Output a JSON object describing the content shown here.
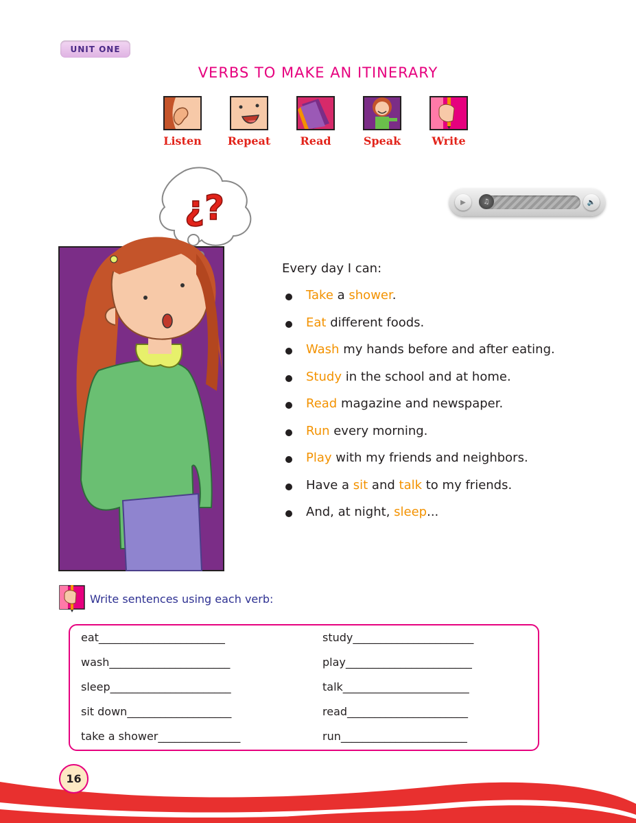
{
  "header": {
    "unit_label": "UNIT ONE",
    "title": "VERBS TO MAKE AN ITINERARY"
  },
  "skills": [
    {
      "label": "Listen",
      "icon": "ear-icon"
    },
    {
      "label": "Repeat",
      "icon": "talking-face-icon"
    },
    {
      "label": "Read",
      "icon": "book-icon"
    },
    {
      "label": "Speak",
      "icon": "speaking-girl-icon"
    },
    {
      "label": "Write",
      "icon": "pencil-hand-icon"
    }
  ],
  "illustration": {
    "thought_symbol": "¿?"
  },
  "content": {
    "intro": "Every day I can:",
    "items": [
      {
        "parts": [
          {
            "t": "Take",
            "hl": true
          },
          {
            "t": " a ",
            "hl": false
          },
          {
            "t": "shower",
            "hl": true
          },
          {
            "t": ".",
            "hl": false
          }
        ]
      },
      {
        "parts": [
          {
            "t": "Eat",
            "hl": true
          },
          {
            "t": " different foods.",
            "hl": false
          }
        ]
      },
      {
        "parts": [
          {
            "t": "Wash",
            "hl": true
          },
          {
            "t": " my hands before and after eating.",
            "hl": false
          }
        ]
      },
      {
        "parts": [
          {
            "t": "Study",
            "hl": true
          },
          {
            "t": " in the school and at home.",
            "hl": false
          }
        ]
      },
      {
        "parts": [
          {
            "t": "Read",
            "hl": true
          },
          {
            "t": " magazine and newspaper.",
            "hl": false
          }
        ]
      },
      {
        "parts": [
          {
            "t": "Run",
            "hl": true
          },
          {
            "t": " every morning.",
            "hl": false
          }
        ]
      },
      {
        "parts": [
          {
            "t": "Play",
            "hl": true
          },
          {
            "t": " with my friends and neighbors.",
            "hl": false
          }
        ]
      },
      {
        "parts": [
          {
            "t": "Have a ",
            "hl": false
          },
          {
            "t": "sit",
            "hl": true
          },
          {
            "t": " and ",
            "hl": false
          },
          {
            "t": "talk",
            "hl": true
          },
          {
            "t": " to my friends.",
            "hl": false
          }
        ]
      },
      {
        "parts": [
          {
            "t": "And, at night, ",
            "hl": false
          },
          {
            "t": "sleep",
            "hl": true
          },
          {
            "t": "...",
            "hl": false
          }
        ]
      }
    ]
  },
  "exercise": {
    "instruction": "Write sentences using each verb:",
    "left": [
      "eat_______________________",
      "wash______________________",
      "sleep______________________",
      "sit down___________________",
      "take a shower_______________"
    ],
    "right": [
      "study______________________",
      "play_______________________",
      "talk_______________________",
      "read______________________",
      "run_______________________"
    ]
  },
  "footer": {
    "page_number": "16"
  },
  "colors": {
    "accent_pink": "#e6007e",
    "verb_orange": "#f39200",
    "label_red": "#e2231a",
    "instruction_blue": "#2e3192",
    "purple_bg": "#7b2d87"
  }
}
